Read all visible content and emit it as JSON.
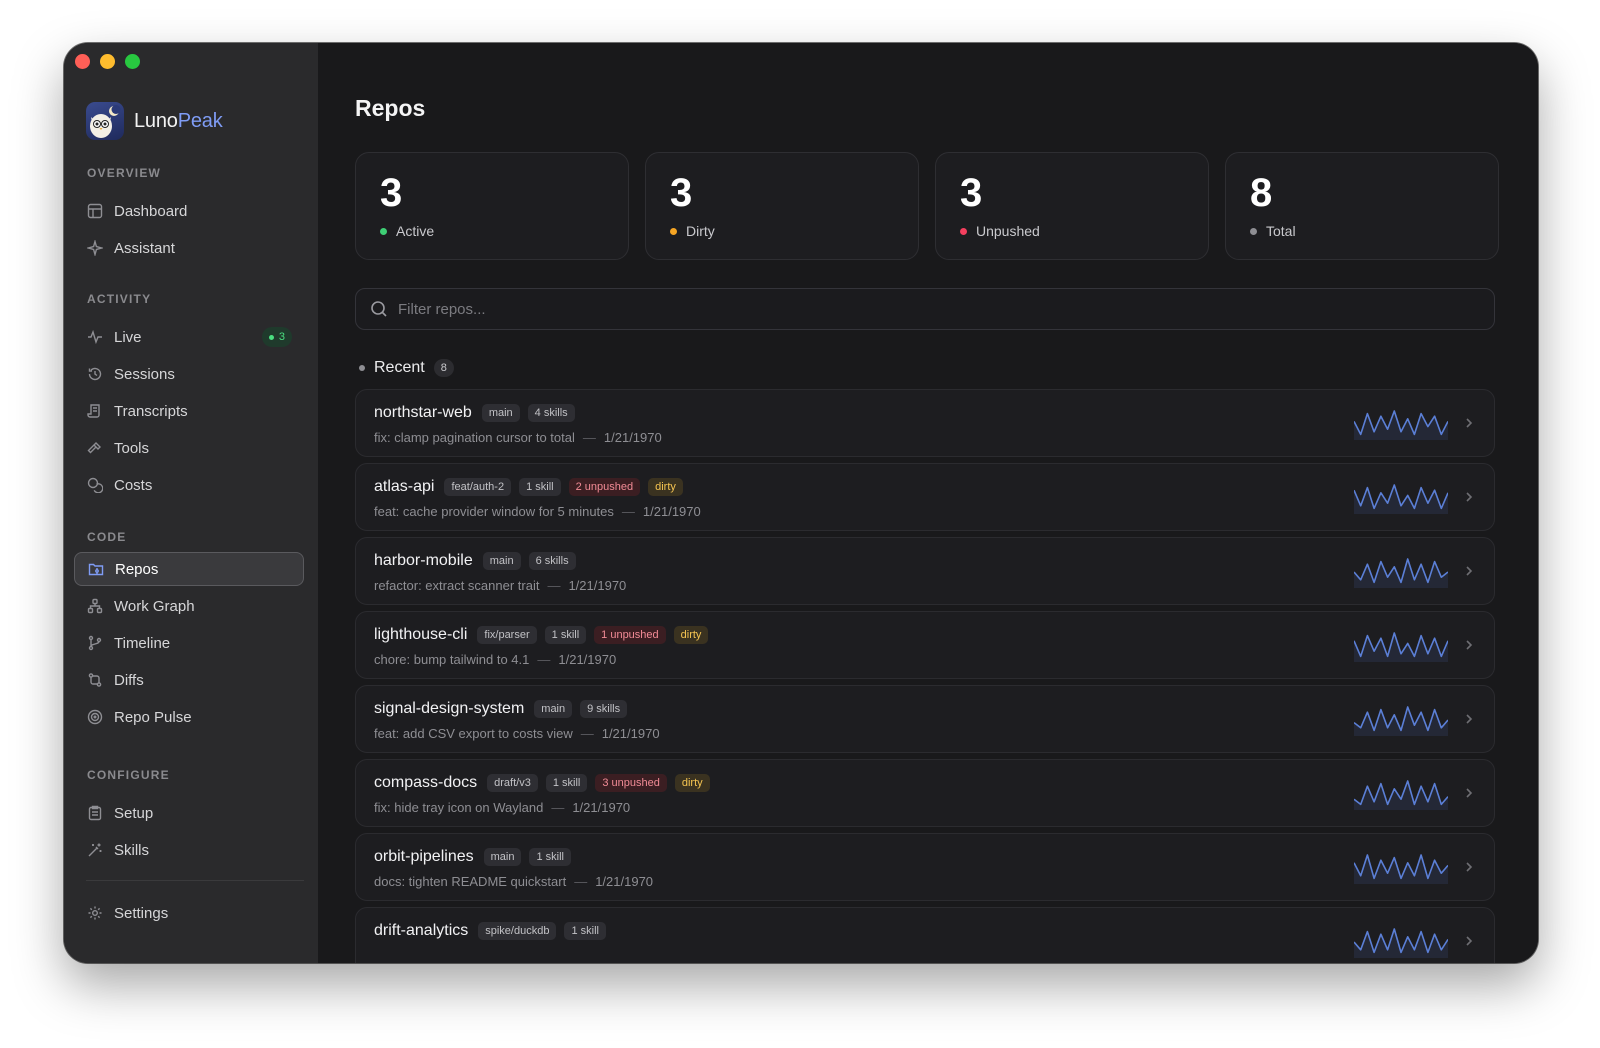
{
  "app": {
    "name_part1": "Luno",
    "name_part2": "Peak"
  },
  "sidebar": {
    "sections": [
      {
        "title": "OVERVIEW",
        "items": [
          {
            "label": "Dashboard",
            "icon": "layout-icon"
          },
          {
            "label": "Assistant",
            "icon": "sparkle-icon"
          }
        ]
      },
      {
        "title": "ACTIVITY",
        "items": [
          {
            "label": "Live",
            "icon": "pulse-icon",
            "badge": "3"
          },
          {
            "label": "Sessions",
            "icon": "history-icon"
          },
          {
            "label": "Transcripts",
            "icon": "scroll-icon"
          },
          {
            "label": "Tools",
            "icon": "hammer-icon"
          },
          {
            "label": "Costs",
            "icon": "coins-icon"
          }
        ]
      },
      {
        "title": "CODE",
        "items": [
          {
            "label": "Repos",
            "icon": "folder-git-icon",
            "active": true
          },
          {
            "label": "Work Graph",
            "icon": "network-icon"
          },
          {
            "label": "Timeline",
            "icon": "branch-icon"
          },
          {
            "label": "Diffs",
            "icon": "diff-icon"
          },
          {
            "label": "Repo Pulse",
            "icon": "radar-icon"
          }
        ]
      },
      {
        "title": "CONFIGURE",
        "items": [
          {
            "label": "Setup",
            "icon": "clipboard-icon"
          },
          {
            "label": "Skills",
            "icon": "wand-icon"
          }
        ]
      }
    ],
    "settings_label": "Settings"
  },
  "page": {
    "title": "Repos"
  },
  "stats": [
    {
      "value": "3",
      "label": "Active",
      "color": "#3ecf75"
    },
    {
      "value": "3",
      "label": "Dirty",
      "color": "#f5a524"
    },
    {
      "value": "3",
      "label": "Unpushed",
      "color": "#f43f5e"
    },
    {
      "value": "8",
      "label": "Total",
      "color": "#8e8e93"
    }
  ],
  "search": {
    "placeholder": "Filter repos..."
  },
  "recent": {
    "label": "Recent",
    "count": "8"
  },
  "repos": [
    {
      "name": "northstar-web",
      "branch": "main",
      "skills": "4 skills",
      "unpushed": "",
      "dirty": "",
      "commit": "fix: clamp pagination cursor to total",
      "date": "1/21/1970"
    },
    {
      "name": "atlas-api",
      "branch": "feat/auth-2",
      "skills": "1 skill",
      "unpushed": "2 unpushed",
      "dirty": "dirty",
      "commit": "feat: cache provider window for 5 minutes",
      "date": "1/21/1970"
    },
    {
      "name": "harbor-mobile",
      "branch": "main",
      "skills": "6 skills",
      "unpushed": "",
      "dirty": "",
      "commit": "refactor: extract scanner trait",
      "date": "1/21/1970"
    },
    {
      "name": "lighthouse-cli",
      "branch": "fix/parser",
      "skills": "1 skill",
      "unpushed": "1 unpushed",
      "dirty": "dirty",
      "commit": "chore: bump tailwind to 4.1",
      "date": "1/21/1970"
    },
    {
      "name": "signal-design-system",
      "branch": "main",
      "skills": "9 skills",
      "unpushed": "",
      "dirty": "",
      "commit": "feat: add CSV export to costs view",
      "date": "1/21/1970"
    },
    {
      "name": "compass-docs",
      "branch": "draft/v3",
      "skills": "1 skill",
      "unpushed": "3 unpushed",
      "dirty": "dirty",
      "commit": "fix: hide tray icon on Wayland",
      "date": "1/21/1970"
    },
    {
      "name": "orbit-pipelines",
      "branch": "main",
      "skills": "1 skill",
      "unpushed": "",
      "dirty": "",
      "commit": "docs: tighten README quickstart",
      "date": "1/21/1970"
    },
    {
      "name": "drift-analytics",
      "branch": "spike/duckdb",
      "skills": "1 skill",
      "unpushed": "",
      "dirty": "",
      "commit": "",
      "date": ""
    }
  ],
  "colors": {
    "accent": "#7f9cf5",
    "sparkline": "#5b7fd6"
  }
}
